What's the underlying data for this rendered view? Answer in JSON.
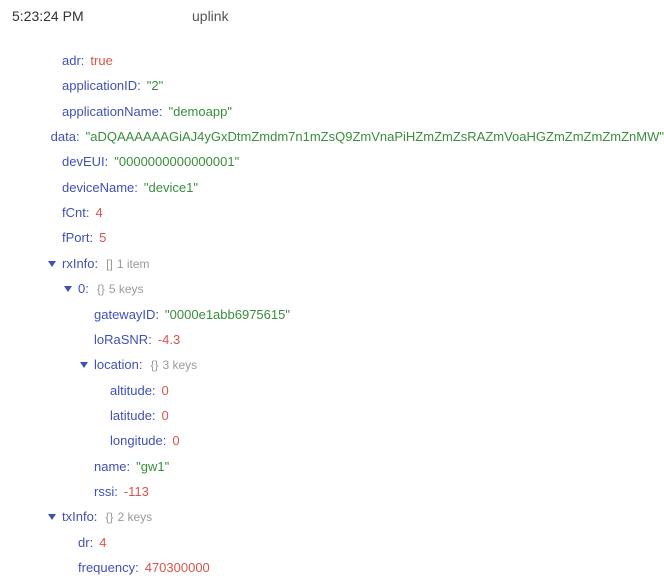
{
  "header": {
    "timestamp": "5:23:24 PM",
    "eventType": "uplink"
  },
  "payload": {
    "adr": "true",
    "applicationID": "2",
    "applicationName": "demoapp",
    "data": "aDQAAAAAAGiAJ4yGxDtmZmdm7n1mZsQ9ZmVnaPiHZmZmZsRAZmVoaHGZmZmZmZmZnMW",
    "devEUI": "0000000000000001",
    "deviceName": "device1",
    "fCnt": "4",
    "fPort": "5"
  },
  "rxInfo": {
    "label": "rxInfo",
    "typeHint": "[]",
    "meta": "1 item",
    "item0": {
      "label": "0",
      "typeHint": "{}",
      "meta": "5 keys",
      "gatewayID": "0000e1abb6975615",
      "loRaSNR": "-4.3",
      "location": {
        "label": "location",
        "typeHint": "{}",
        "meta": "3 keys",
        "altitude": "0",
        "latitude": "0",
        "longitude": "0"
      },
      "name": "gw1",
      "rssi": "-113"
    }
  },
  "txInfo": {
    "label": "txInfo",
    "typeHint": "{}",
    "meta": "2 keys",
    "dr": "4",
    "frequency": "470300000"
  }
}
